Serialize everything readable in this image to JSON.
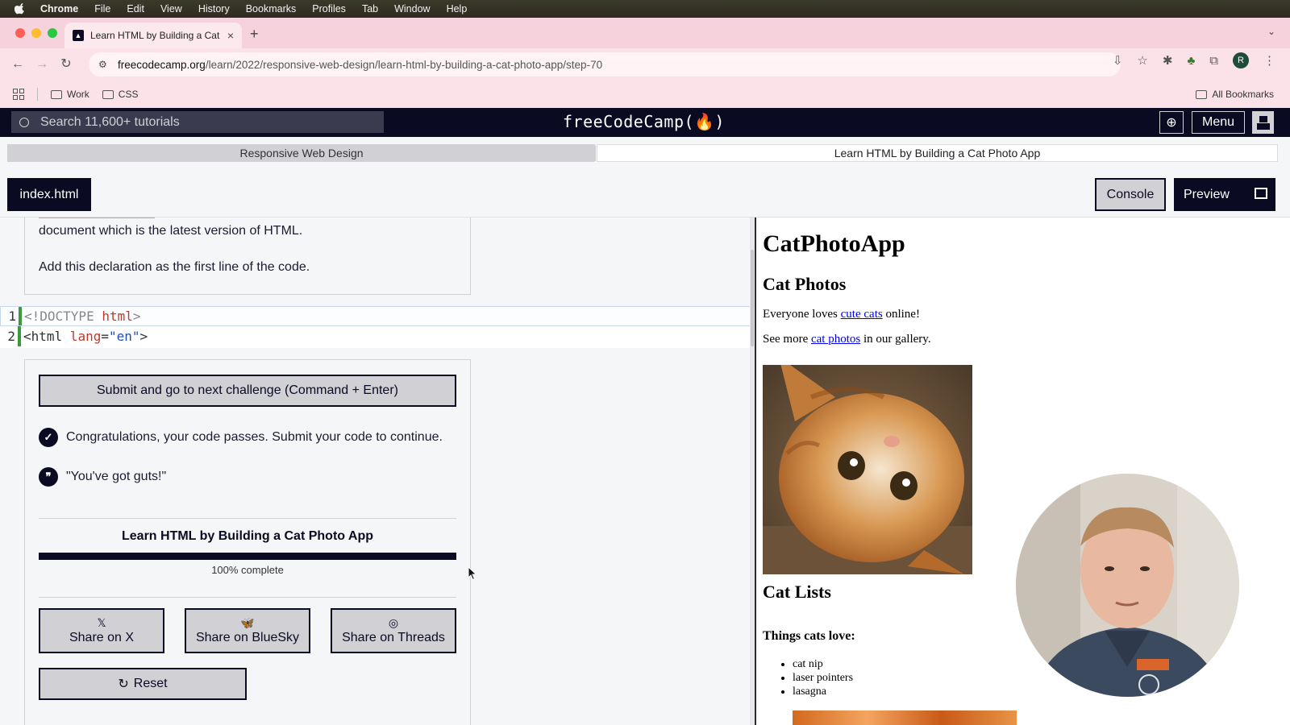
{
  "menubar": {
    "items": [
      "Chrome",
      "File",
      "Edit",
      "View",
      "History",
      "Bookmarks",
      "Profiles",
      "Tab",
      "Window",
      "Help"
    ]
  },
  "browser": {
    "tab_title": "Learn HTML by Building a Cat",
    "url_host": "freecodecamp.org",
    "url_path": "/learn/2022/responsive-web-design/learn-html-by-building-a-cat-photo-app/step-70",
    "profile_initial": "R",
    "bookmarks": [
      "Work",
      "CSS"
    ],
    "all_bookmarks": "All Bookmarks"
  },
  "fcc": {
    "search_placeholder": "Search 11,600+ tutorials",
    "logo": "freeCodeCamp(🔥)",
    "menu_label": "Menu",
    "breadcrumb": [
      "Responsive Web Design",
      "Learn HTML by Building a Cat Photo App"
    ],
    "file_tab": "index.html",
    "console_label": "Console",
    "preview_label": "Preview"
  },
  "description": {
    "line1": "document which is the latest version of HTML.",
    "line2": "Add this declaration as the first line of the code."
  },
  "code": {
    "lines": [
      {
        "num": "1",
        "parts": [
          "<!DOCTYPE",
          " html",
          ">"
        ]
      },
      {
        "num": "2",
        "parts": [
          "<html",
          " lang",
          "=",
          "\"en\"",
          ">"
        ]
      }
    ]
  },
  "panel": {
    "submit_label": "Submit and go to next challenge (Command + Enter)",
    "pass_message": "Congratulations, your code passes. Submit your code to continue.",
    "quote": "\"You've got guts!\"",
    "progress_title": "Learn HTML by Building a Cat Photo App",
    "progress_fraction": 1.0,
    "progress_text": "100% complete",
    "share": [
      {
        "label": "Share on X",
        "icon": "x-logo-icon"
      },
      {
        "label": "Share on BlueSky",
        "icon": "butterfly-icon"
      },
      {
        "label": "Share on Threads",
        "icon": "threads-icon"
      }
    ],
    "reset_label": "Reset"
  },
  "preview": {
    "h1": "CatPhotoApp",
    "h2_photos": "Cat Photos",
    "p1_before": "Everyone loves ",
    "p1_link": "cute cats",
    "p1_after": " online!",
    "p2_before": "See more ",
    "p2_link": "cat photos",
    "p2_after": " in our gallery.",
    "h2_lists": "Cat Lists",
    "h3_love": "Things cats love:",
    "list": [
      "cat nip",
      "laser pointers",
      "lasagna"
    ]
  },
  "colors": {
    "fcc_dark": "#0a0a23",
    "fcc_gray": "#d0d0d5",
    "tab_pink": "#f6d3dc"
  }
}
